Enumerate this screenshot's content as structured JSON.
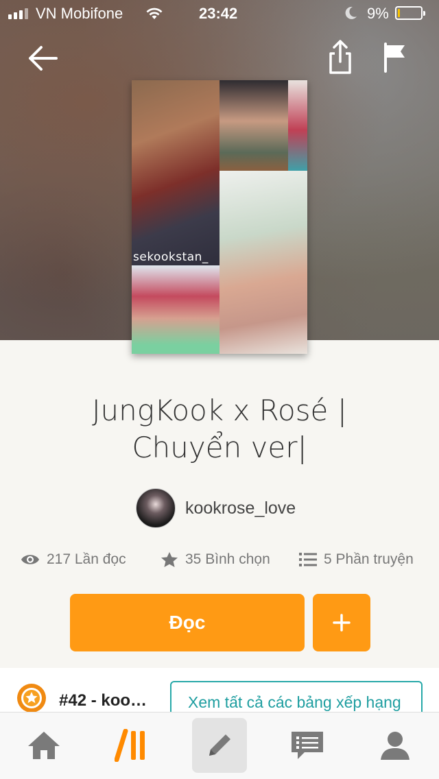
{
  "status_bar": {
    "carrier": "VN Mobifone",
    "time": "23:42",
    "battery_percent": "9%",
    "battery_level": 0.09
  },
  "header": {
    "back_icon": "arrow-left-icon",
    "share_icon": "share-icon",
    "report_icon": "flag-icon"
  },
  "cover": {
    "watermark": "sekookstan_"
  },
  "story": {
    "title_line1": "JungKook x Rosé |",
    "title_line2": "Chuyển ver|",
    "author": "kookrose_love"
  },
  "stats": {
    "reads": "217 Lần đọc",
    "votes": "35 Bình chọn",
    "parts": "5 Phần truyện"
  },
  "actions": {
    "read_label": "Đọc",
    "add_icon": "plus-icon"
  },
  "ranking": {
    "rank_text": "#42 - koo…",
    "view_all_label": "Xem tất cả các bảng xếp hạng"
  },
  "tabbar": {
    "items": [
      "home-icon",
      "library-icon",
      "write-icon",
      "messages-icon",
      "profile-icon"
    ]
  },
  "colors": {
    "accent": "#ff9a14",
    "teal": "#1e9ea0",
    "battery": "#f7c300"
  }
}
